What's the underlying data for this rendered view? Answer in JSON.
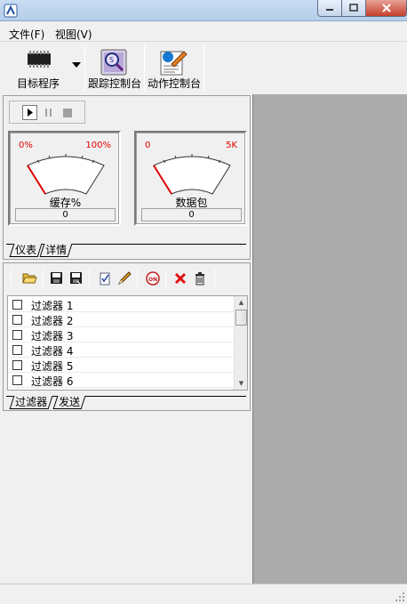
{
  "menu": {
    "file": "文件(F)",
    "view": "视图(V)"
  },
  "toolbar": {
    "target_program": "目标程序",
    "trace_console": "跟踪控制台",
    "action_console": "动作控制台"
  },
  "meters": {
    "gauges": [
      {
        "min_label": "0%",
        "max_label": "100%",
        "label": "缓存%",
        "value": "0"
      },
      {
        "min_label": "0",
        "max_label": "5K",
        "label": "数据包",
        "value": "0"
      }
    ],
    "tabs": [
      "仪表",
      "详情"
    ]
  },
  "filters": {
    "items": [
      "过滤器 1",
      "过滤器 2",
      "过滤器 3",
      "过滤器 4",
      "过滤器 5",
      "过滤器 6"
    ],
    "tabs": [
      "过滤器",
      "发送"
    ]
  },
  "colors": {
    "gauge_red": "#e00000",
    "workspace": "#ababab"
  }
}
